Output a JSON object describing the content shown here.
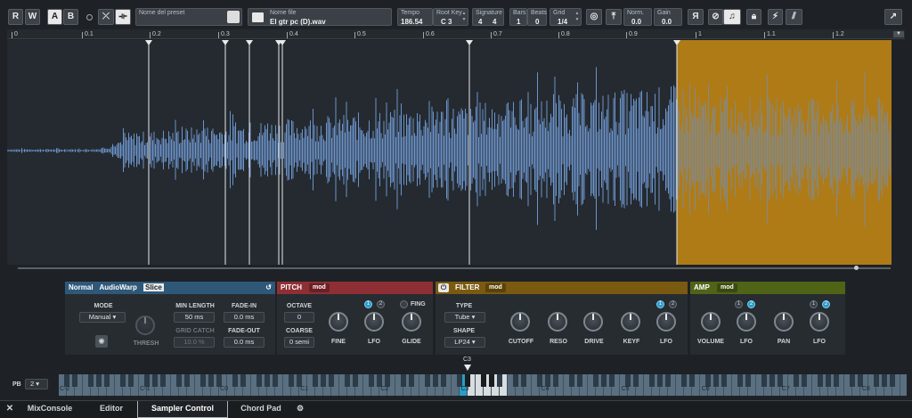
{
  "toolbar": {
    "r": "R",
    "w": "W",
    "a": "A",
    "b": "B",
    "preset_label": "Nome del preset",
    "file_label": "Nome file",
    "file_value": "El gtr pc (D).wav",
    "tempo_label": "Tempo",
    "tempo_value": "186.54",
    "rootkey_label": "Root Key",
    "rootkey_value": "C 3",
    "signature_label": "Signature",
    "sig_num": "4",
    "sig_den": "4",
    "bars_label": "Bars",
    "bars_value": "1",
    "beats_label": "Beats",
    "beats_value": "0",
    "grid_label": "Grid",
    "grid_value": "1/4",
    "norm_label": "Norm.",
    "norm_value": "0.0",
    "gain_label": "Gain",
    "gain_value": "0.0",
    "r_icon": "Я"
  },
  "ruler": [
    "0",
    "0.1",
    "0.2",
    "0.3",
    "0.4",
    "0.5",
    "0.6",
    "0.7",
    "0.8",
    "0.9",
    "1",
    "1.1",
    "1.2"
  ],
  "slice_panel": {
    "tab_normal": "Normal",
    "tab_audiowarp": "AudioWarp",
    "tab_slice": "Slice",
    "mode_label": "MODE",
    "mode_value": "Manual",
    "thresh_label": "THRESH",
    "min_length_label": "MIN LENGTH",
    "min_length_value": "50 ms",
    "grid_catch_label": "GRID CATCH",
    "grid_catch_value": "10.0 %",
    "fade_in_label": "FADE-IN",
    "fade_in_value": "0.0 ms",
    "fade_out_label": "FADE-OUT",
    "fade_out_value": "0.0 ms"
  },
  "pitch_panel": {
    "title": "PITCH",
    "mod": "mod",
    "octave_label": "OCTAVE",
    "octave_value": "0",
    "coarse_label": "COARSE",
    "coarse_value": "0 semi",
    "fine_label": "FINE",
    "lfo_label": "LFO",
    "glide_label": "GLIDE",
    "fing_label": "FING",
    "n1": "1",
    "n2": "2"
  },
  "filter_panel": {
    "title": "FILTER",
    "mod": "mod",
    "type_label": "TYPE",
    "type_value": "Tube",
    "shape_label": "SHAPE",
    "shape_value": "LP24",
    "cutoff_label": "CUTOFF",
    "reso_label": "RESO",
    "drive_label": "DRIVE",
    "keyf_label": "KEYF",
    "lfo_label": "LFO",
    "n1": "1",
    "n2": "2"
  },
  "amp_panel": {
    "title": "AMP",
    "mod": "mod",
    "volume_label": "VOLUME",
    "lfo_label": "LFO",
    "pan_label": "PAN",
    "lfo2_label": "LFO",
    "n1": "1",
    "n2": "2"
  },
  "keyboard": {
    "pb_label": "PB",
    "pb_value": "2",
    "root_marker": "C3",
    "octaves": [
      "C-2",
      "C-1",
      "C0",
      "C1",
      "C2",
      "C3",
      "C4",
      "C5",
      "C6",
      "C7",
      "C8"
    ]
  },
  "tabs": {
    "mixconsole": "MixConsole",
    "editor": "Editor",
    "sampler": "Sampler Control",
    "chordpad": "Chord Pad"
  },
  "colors": {
    "waveform": "#6b93c9",
    "selection": "#b07c18",
    "slice_header": "#2f5878",
    "pitch_header": "#8e2f35",
    "filter_header": "#7a5a10",
    "amp_header": "#4f6416"
  }
}
